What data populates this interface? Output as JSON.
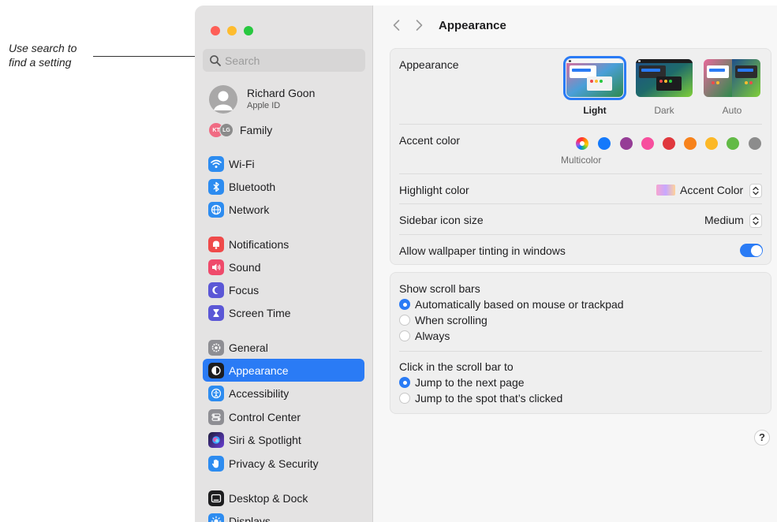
{
  "annotation": {
    "text_line1": "Use search to",
    "text_line2": "find a setting"
  },
  "search": {
    "placeholder": "Search"
  },
  "profile": {
    "name": "Richard Goon",
    "subtitle": "Apple ID"
  },
  "family": {
    "label": "Family",
    "avatars": [
      "KT",
      "LG"
    ]
  },
  "sidebar": {
    "items": [
      {
        "label": "Wi-Fi",
        "icon": "wifi-icon",
        "color": "#2d8cf0"
      },
      {
        "label": "Bluetooth",
        "icon": "bluetooth-icon",
        "color": "#2d8cf0"
      },
      {
        "label": "Network",
        "icon": "globe-icon",
        "color": "#2d8cf0"
      },
      {
        "label": "Notifications",
        "icon": "bell-icon",
        "color": "#ef4a4a"
      },
      {
        "label": "Sound",
        "icon": "speaker-icon",
        "color": "#ef4a6b"
      },
      {
        "label": "Focus",
        "icon": "moon-icon",
        "color": "#5b57d6"
      },
      {
        "label": "Screen Time",
        "icon": "hourglass-icon",
        "color": "#5b57d6"
      },
      {
        "label": "General",
        "icon": "gear-icon",
        "color": "#8e8e93"
      },
      {
        "label": "Appearance",
        "icon": "appearance-icon",
        "color": "#1d1d1f"
      },
      {
        "label": "Accessibility",
        "icon": "accessibility-icon",
        "color": "#2d8cf0"
      },
      {
        "label": "Control Center",
        "icon": "control-center-icon",
        "color": "#8e8e93"
      },
      {
        "label": "Siri & Spotlight",
        "icon": "siri-icon",
        "color": "#6a3fd6"
      },
      {
        "label": "Privacy & Security",
        "icon": "hand-icon",
        "color": "#2d8cf0"
      },
      {
        "label": "Desktop & Dock",
        "icon": "dock-icon",
        "color": "#1d1d1f"
      },
      {
        "label": "Displays",
        "icon": "sun-icon",
        "color": "#2d8cf0"
      }
    ],
    "selected": "Appearance"
  },
  "header": {
    "title": "Appearance"
  },
  "appearance": {
    "label": "Appearance",
    "options": [
      "Light",
      "Dark",
      "Auto"
    ],
    "selected": "Light"
  },
  "accent": {
    "label": "Accent color",
    "selected_label": "Multicolor",
    "colors": [
      "multicolor",
      "#1479fb",
      "#953d96",
      "#f74f9e",
      "#e0383e",
      "#f7821b",
      "#fcb827",
      "#62ba46",
      "#8c8c8c"
    ]
  },
  "highlight": {
    "label": "Highlight color",
    "value": "Accent Color"
  },
  "icon_size": {
    "label": "Sidebar icon size",
    "value": "Medium"
  },
  "tinting": {
    "label": "Allow wallpaper tinting in windows",
    "enabled": true
  },
  "scroll_bars": {
    "label": "Show scroll bars",
    "options": [
      "Automatically based on mouse or trackpad",
      "When scrolling",
      "Always"
    ],
    "selected": "Automatically based on mouse or trackpad"
  },
  "scroll_click": {
    "label": "Click in the scroll bar to",
    "options": [
      "Jump to the next page",
      "Jump to the spot that’s clicked"
    ],
    "selected": "Jump to the next page"
  },
  "help": {
    "label": "?"
  }
}
